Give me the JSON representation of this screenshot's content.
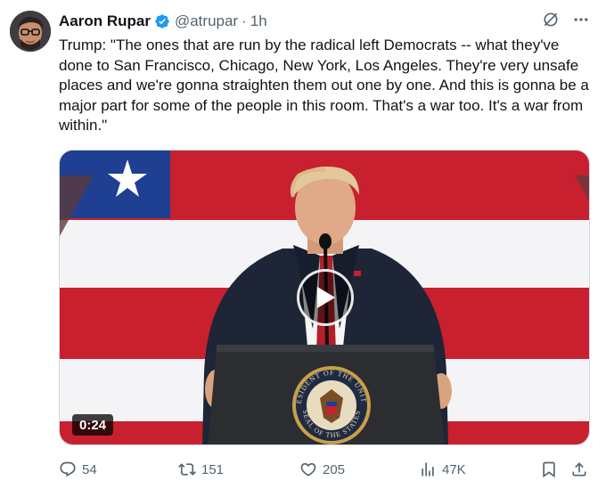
{
  "author": {
    "name": "Aaron Rupar",
    "handle": "@atrupar",
    "separator": "·",
    "time": "1h"
  },
  "tweet": {
    "text": "Trump: \"The ones that are run by the radical left Democrats -- what they've done to San Francisco, Chicago, New York, Los Angeles. They're very unsafe places and we're gonna straighten them out one by one. And this is gonna be a major part for some of the people in this room. That's a war too. It's a war from within.\""
  },
  "video": {
    "duration": "0:24",
    "seal_top_text": "PRESIDENT OF THE UNITED",
    "seal_bottom_text": "SEAL OF THE STATES"
  },
  "actions": {
    "replies": "54",
    "reposts": "151",
    "likes": "205",
    "views": "47K"
  },
  "colors": {
    "verified": "#1d9bf0",
    "secondary_text": "#536471",
    "flag_red": "#c8202f",
    "flag_blue": "#1f3f93",
    "podium": "#2b2d31"
  },
  "icons": [
    "verified-badge-icon",
    "grok-icon",
    "more-icon",
    "reply-icon",
    "repost-icon",
    "like-icon",
    "views-icon",
    "bookmark-icon",
    "share-icon",
    "play-icon"
  ]
}
